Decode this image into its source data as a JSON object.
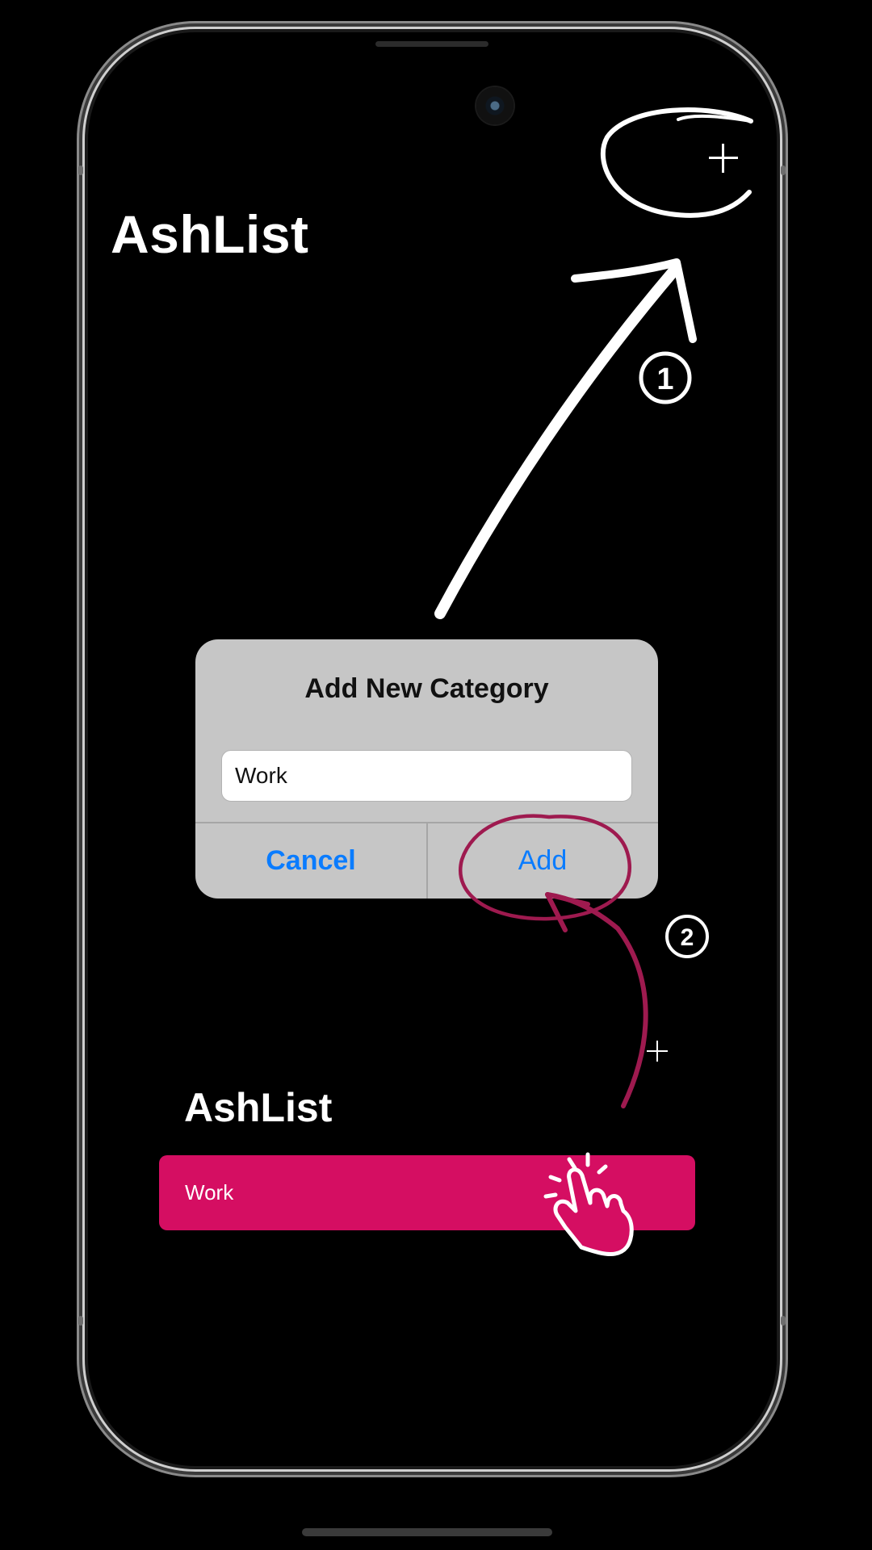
{
  "main": {
    "app_title": "AshList"
  },
  "alert": {
    "title": "Add New Category",
    "input_value": "Work",
    "cancel_label": "Cancel",
    "add_label": "Add",
    "button_color": "#0A7CFF"
  },
  "result": {
    "app_title": "AshList",
    "categories": [
      {
        "label": "Work",
        "color": "#D50E62"
      }
    ]
  },
  "annotations": {
    "step1": "1",
    "step2": "2",
    "step1_color": "#FFFFFF",
    "step2_color": "#9E1A4F"
  },
  "icons": {
    "add_button": "plus-icon",
    "tap_hint": "hand-tap-icon"
  }
}
